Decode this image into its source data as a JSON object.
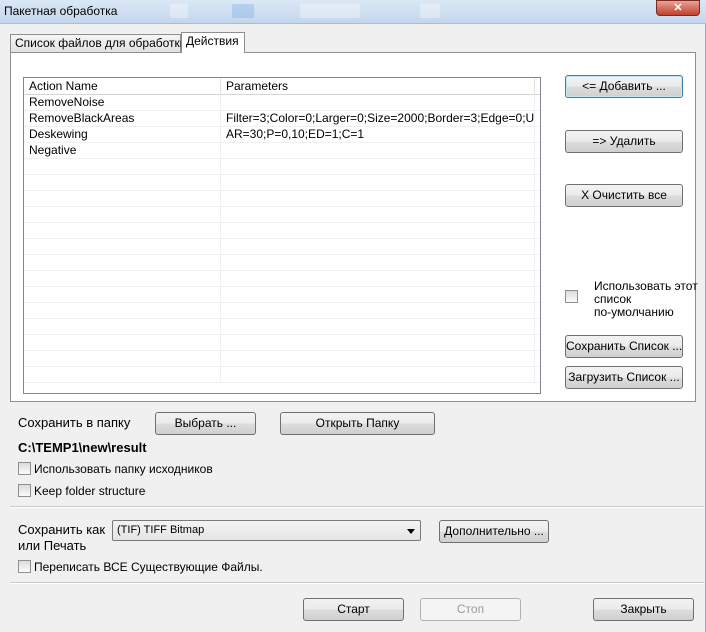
{
  "window": {
    "title": "Пакетная обработка",
    "close_glyph": "✕"
  },
  "tabs": [
    {
      "label": "Список файлов для обработки"
    },
    {
      "label": "Действия",
      "active": true
    }
  ],
  "grid": {
    "columns": [
      "Action Name",
      "Parameters"
    ],
    "rows": [
      {
        "action": "RemoveNoise",
        "params": ""
      },
      {
        "action": "RemoveBlackAreas",
        "params": "Filter=3;Color=0;Larger=0;Size=2000;Border=3;Edge=0;U..."
      },
      {
        "action": "Deskewing",
        "params": "AR=30;P=0,10;ED=1;C=1"
      },
      {
        "action": "Negative",
        "params": ""
      }
    ]
  },
  "side_buttons": {
    "add": "<= Добавить ...",
    "remove": "=> Удалить",
    "clear": "X Очистить все",
    "default_list_line1": "Использовать этот",
    "default_list_line2": "список",
    "default_list_line3": "по-умолчанию",
    "save_list": "Сохранить Список ...",
    "load_list": "Загрузить Список ..."
  },
  "output": {
    "save_to_folder_label": "Сохранить в папку",
    "choose_button": "Выбрать ...",
    "open_folder_button": "Открыть Папку",
    "path": "C:\\TEMP1\\new\\result",
    "use_source_folder": "Использовать папку исходников",
    "keep_structure": "Keep folder structure"
  },
  "save_as": {
    "label_line1": "Сохранить как",
    "label_line2": "или Печать",
    "format": "(TIF) TIFF Bitmap",
    "advanced_button": "Дополнительно ...",
    "overwrite_label": "Переписать ВСЕ Существующие Файлы."
  },
  "footer": {
    "start": "Старт",
    "stop": "Стоп",
    "close": "Закрыть"
  }
}
